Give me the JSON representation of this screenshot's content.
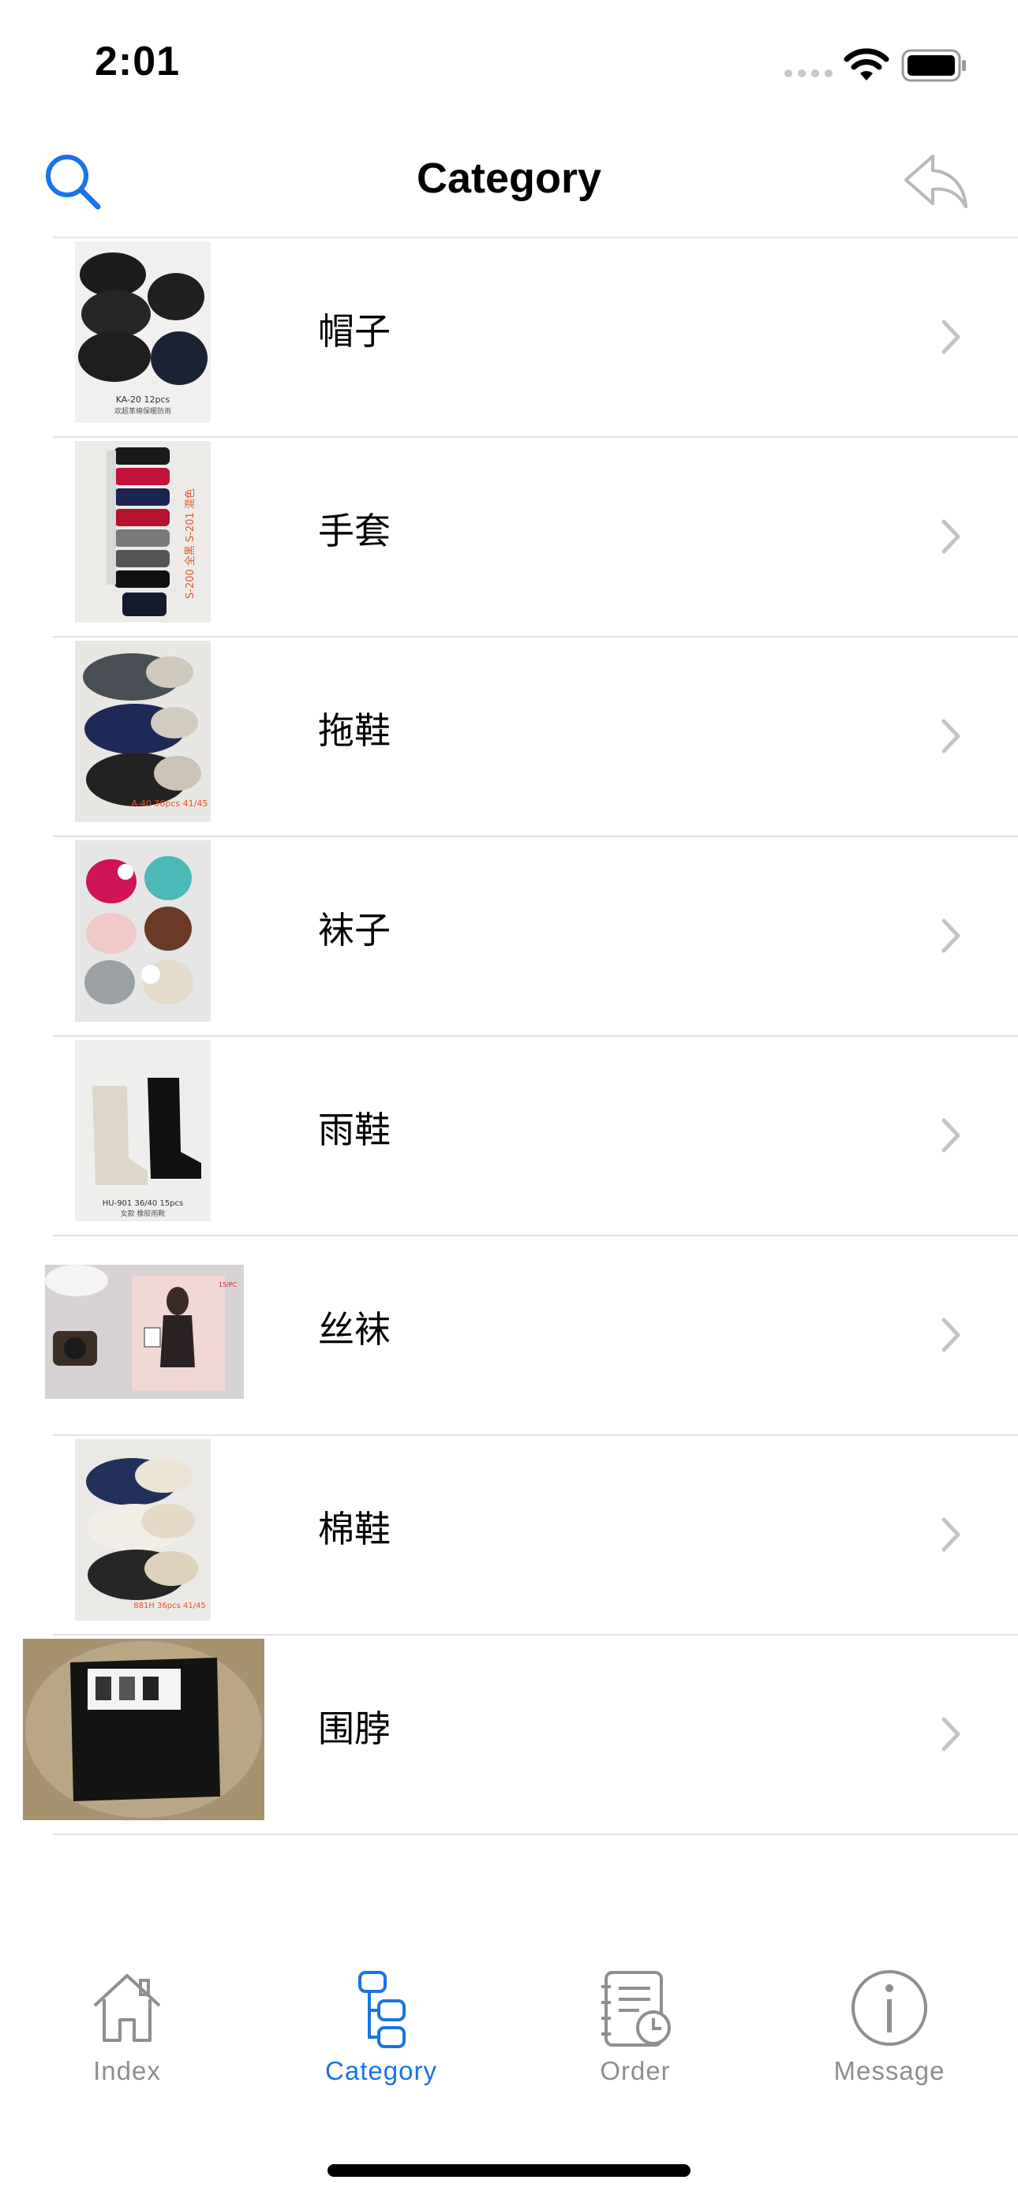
{
  "status_bar": {
    "time": "2:01"
  },
  "nav": {
    "title": "Category",
    "search_icon": "search-icon",
    "back_icon": "reply-arrow-icon"
  },
  "categories": [
    {
      "label": "帽子"
    },
    {
      "label": "手套"
    },
    {
      "label": "拖鞋"
    },
    {
      "label": "袜子"
    },
    {
      "label": "雨鞋"
    },
    {
      "label": "丝袜"
    },
    {
      "label": "棉鞋"
    },
    {
      "label": "围脖"
    }
  ],
  "thumb_captions": {
    "hats": "KA-20 12pcs",
    "gloves": "S-200 全黑 S-201 混色",
    "slippers": "A-40 36pcs 41/45",
    "boots": "HU-901 36/40 15pcs",
    "cotton_shoes": "881H 36pcs 41/45"
  },
  "tabs": [
    {
      "label": "Index",
      "icon": "house-icon",
      "active": false
    },
    {
      "label": "Category",
      "icon": "category-tree-icon",
      "active": true
    },
    {
      "label": "Order",
      "icon": "order-history-icon",
      "active": false
    },
    {
      "label": "Message",
      "icon": "info-icon",
      "active": false
    }
  ],
  "colors": {
    "accent": "#1a73e8",
    "inactive": "#8e8e93",
    "separator": "#e3e3e3",
    "chevron": "#c4c4c6"
  }
}
